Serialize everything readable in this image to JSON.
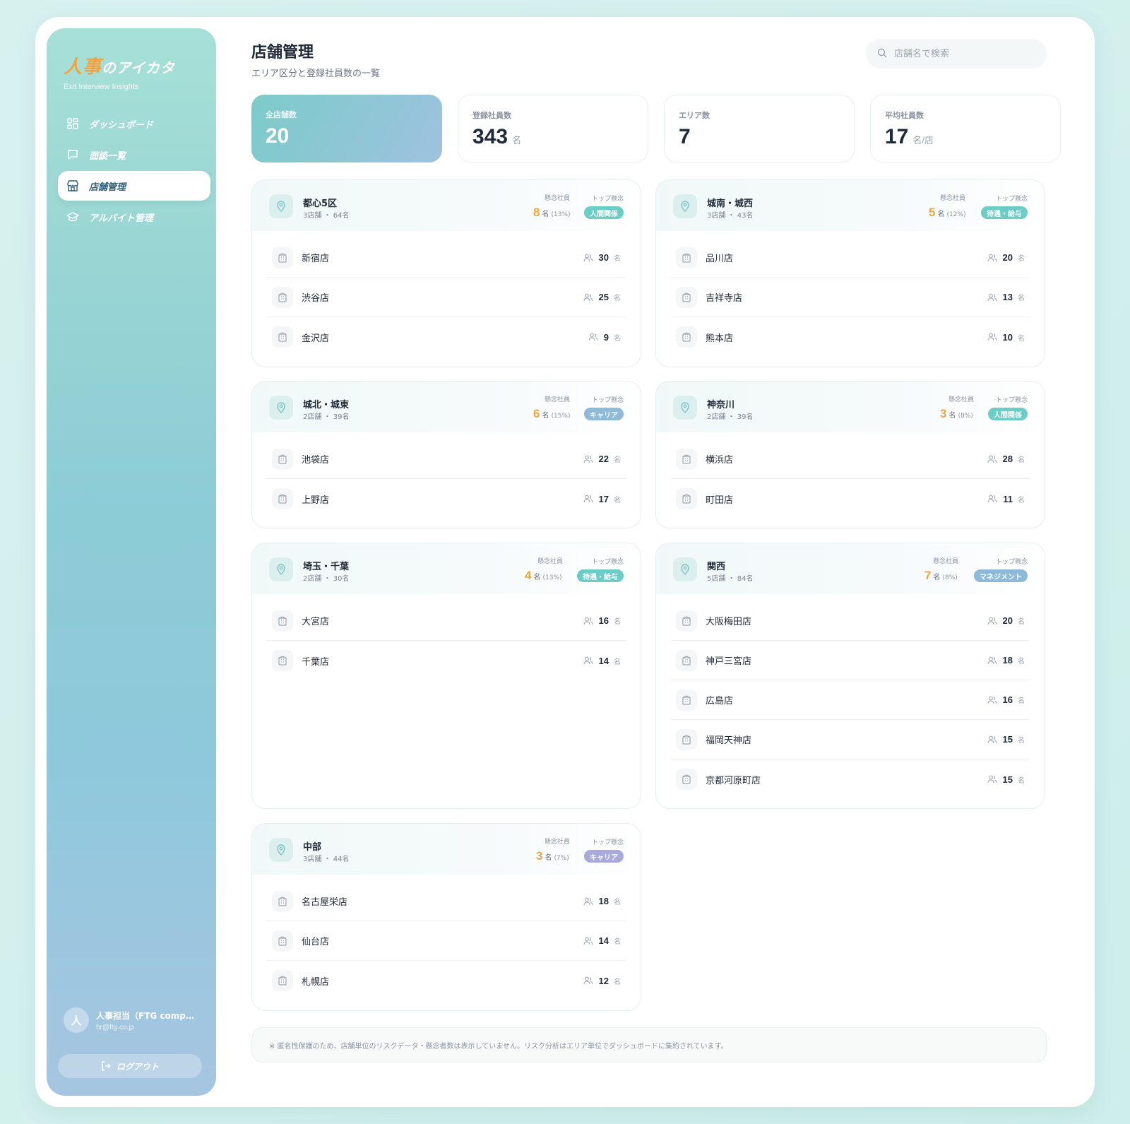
{
  "brand": {
    "logo_accent": "人事",
    "logo_rest": "のアイカタ",
    "tagline": "Exit Interview Insights"
  },
  "nav": [
    {
      "label": "ダッシュボード",
      "icon": "grid-icon",
      "active": false
    },
    {
      "label": "面談一覧",
      "icon": "chat-icon",
      "active": false
    },
    {
      "label": "店舗管理",
      "icon": "store-icon",
      "active": true
    },
    {
      "label": "アルバイト管理",
      "icon": "graduation-cap-icon",
      "active": false
    }
  ],
  "user": {
    "avatar": "人",
    "name": "人事担当（FTG company）",
    "email": "hr@ftg.co.jp"
  },
  "logout_label": "ログアウト",
  "header": {
    "title": "店舗管理",
    "subtitle": "エリア区分と登録社員数の一覧"
  },
  "search": {
    "placeholder": "店舗名で検索"
  },
  "stats": [
    {
      "label": "全店舗数",
      "value": "20",
      "unit": ""
    },
    {
      "label": "登録社員数",
      "value": "343",
      "unit": "名"
    },
    {
      "label": "エリア数",
      "value": "7",
      "unit": ""
    },
    {
      "label": "平均社員数",
      "value": "17",
      "unit": "名/店"
    }
  ],
  "labels": {
    "concern": "懸念社員",
    "top_concern": "トップ懸念",
    "person_unit": "名"
  },
  "colors": {
    "concern_number": "#f3a43d",
    "badge_teal": "#6ccdc6",
    "badge_blue": "#8ebad9",
    "badge_purple": "#a9a9dc"
  },
  "areas": [
    {
      "name": "都心5区",
      "meta": "3店舗 ・ 64名",
      "concern": "8",
      "concern_pct": "(13%)",
      "top": "人間関係",
      "badge_color": "#6ccdc6",
      "stores": [
        {
          "name": "新宿店",
          "count": "30"
        },
        {
          "name": "渋谷店",
          "count": "25"
        },
        {
          "name": "金沢店",
          "count": "9"
        }
      ]
    },
    {
      "name": "城南・城西",
      "meta": "3店舗 ・ 43名",
      "concern": "5",
      "concern_pct": "(12%)",
      "top": "待遇・給与",
      "badge_color": "#6ccdc6",
      "stores": [
        {
          "name": "品川店",
          "count": "20"
        },
        {
          "name": "吉祥寺店",
          "count": "13"
        },
        {
          "name": "熊本店",
          "count": "10"
        }
      ]
    },
    {
      "name": "城北・城東",
      "meta": "2店舗 ・ 39名",
      "concern": "6",
      "concern_pct": "(15%)",
      "top": "キャリア",
      "badge_color": "#8ebad9",
      "stores": [
        {
          "name": "池袋店",
          "count": "22"
        },
        {
          "name": "上野店",
          "count": "17"
        }
      ]
    },
    {
      "name": "神奈川",
      "meta": "2店舗 ・ 39名",
      "concern": "3",
      "concern_pct": "(8%)",
      "top": "人間関係",
      "badge_color": "#6ccdc6",
      "stores": [
        {
          "name": "横浜店",
          "count": "28"
        },
        {
          "name": "町田店",
          "count": "11"
        }
      ]
    },
    {
      "name": "埼玉・千葉",
      "meta": "2店舗 ・ 30名",
      "concern": "4",
      "concern_pct": "(13%)",
      "top": "待遇・給与",
      "badge_color": "#6ccdc6",
      "stores": [
        {
          "name": "大宮店",
          "count": "16"
        },
        {
          "name": "千葉店",
          "count": "14"
        }
      ]
    },
    {
      "name": "関西",
      "meta": "5店舗 ・ 84名",
      "concern": "7",
      "concern_pct": "(8%)",
      "top": "マネジメント",
      "badge_color": "#8ebad9",
      "stores": [
        {
          "name": "大阪梅田店",
          "count": "20"
        },
        {
          "name": "神戸三宮店",
          "count": "18"
        },
        {
          "name": "広島店",
          "count": "16"
        },
        {
          "name": "福岡天神店",
          "count": "15"
        },
        {
          "name": "京都河原町店",
          "count": "15"
        }
      ]
    },
    {
      "name": "中部",
      "meta": "3店舗 ・ 44名",
      "concern": "3",
      "concern_pct": "(7%)",
      "top": "キャリア",
      "badge_color": "#a9a9dc",
      "stores": [
        {
          "name": "名古屋栄店",
          "count": "18"
        },
        {
          "name": "仙台店",
          "count": "14"
        },
        {
          "name": "札幌店",
          "count": "12"
        }
      ]
    }
  ],
  "footnote": "※ 匿名性保護のため、店舗単位のリスクデータ・懸念者数は表示していません。リスク分析はエリア単位でダッシュボードに集約されています。"
}
